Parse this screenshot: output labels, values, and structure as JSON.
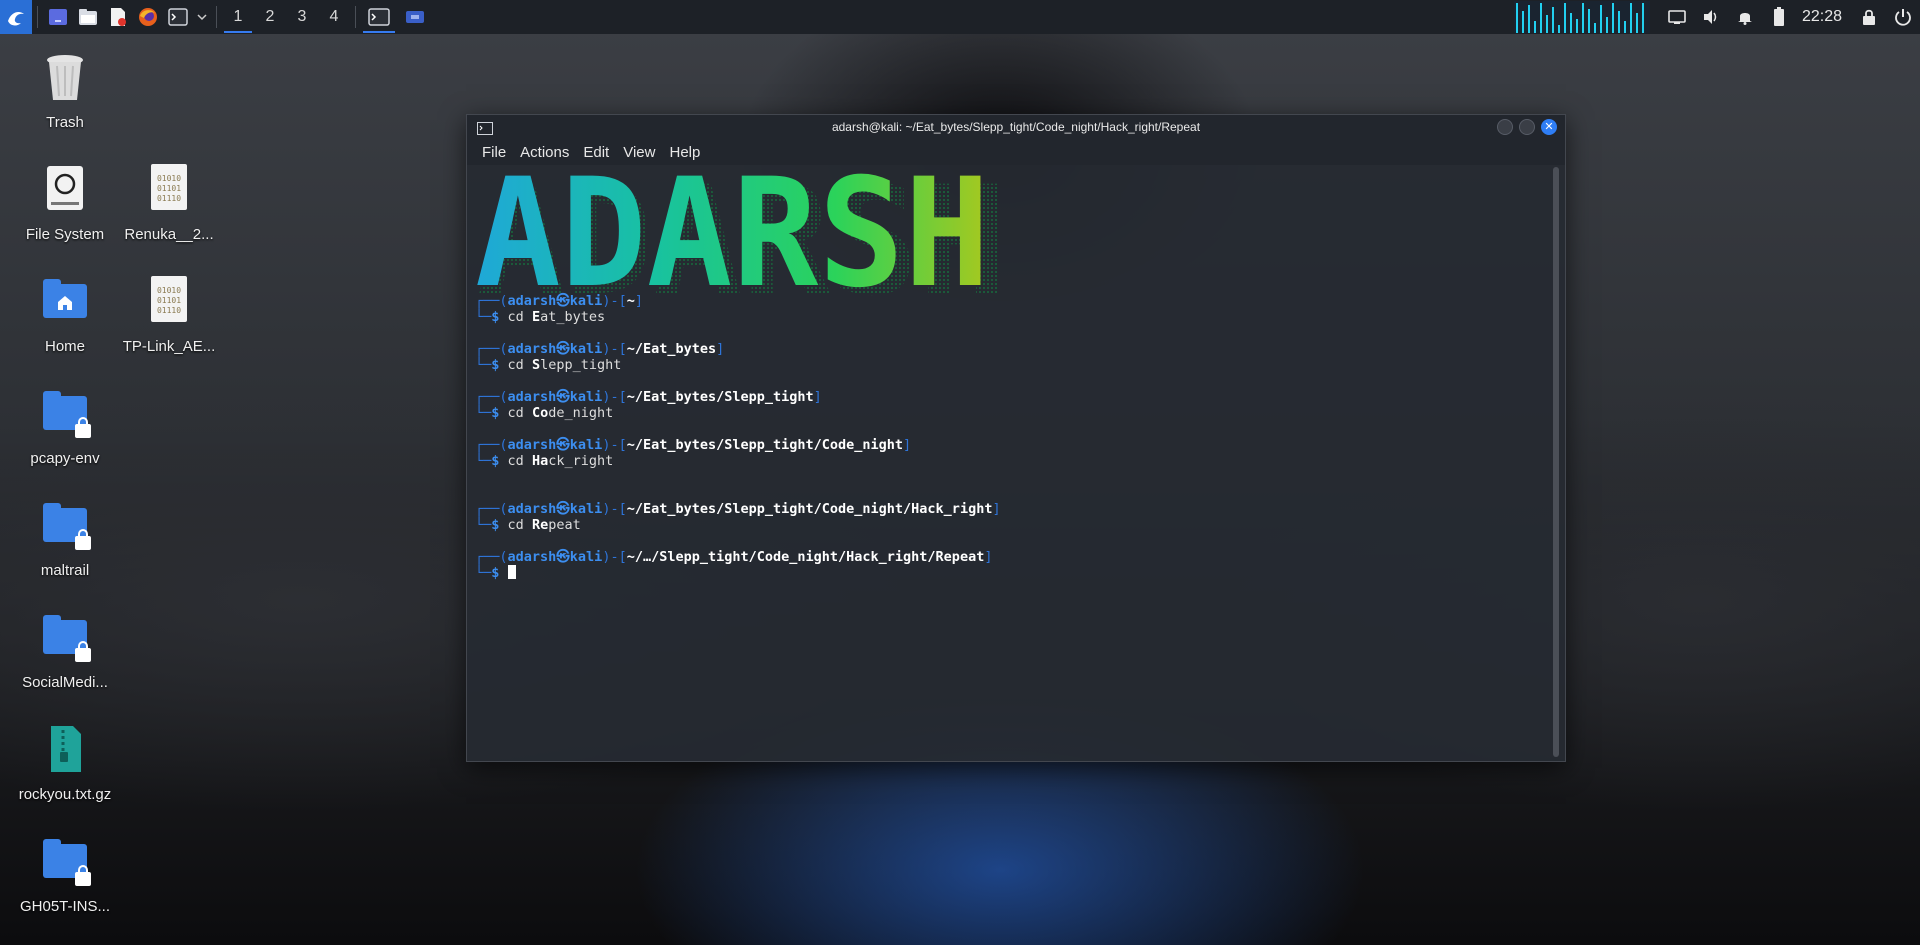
{
  "panel": {
    "workspaces": [
      "1",
      "2",
      "3",
      "4"
    ],
    "clock": "22:28",
    "icons": [
      "kali-menu-icon",
      "show-desktop-icon",
      "file-manager-icon",
      "text-editor-icon",
      "firefox-icon",
      "terminal-icon"
    ]
  },
  "desktop": {
    "icons": [
      {
        "label": "Trash",
        "icon": "trash-icon"
      },
      {
        "label": "File System",
        "icon": "drive-icon"
      },
      {
        "label": "Renuka__2...",
        "icon": "binary-file-icon"
      },
      {
        "label": "Home",
        "icon": "home-folder-icon"
      },
      {
        "label": "TP-Link_AE...",
        "icon": "binary-file-icon"
      },
      {
        "label": "pcapy-env",
        "icon": "locked-folder-icon"
      },
      {
        "label": "maltrail",
        "icon": "locked-folder-icon"
      },
      {
        "label": "SocialMedi...",
        "icon": "locked-folder-icon"
      },
      {
        "label": "rockyou.txt.gz",
        "icon": "archive-icon"
      },
      {
        "label": "GH05T-INS...",
        "icon": "locked-folder-icon"
      }
    ]
  },
  "terminal": {
    "title": "adarsh@kali: ~/Eat_bytes/Slepp_tight/Code_night/Hack_right/Repeat",
    "menu": [
      "File",
      "Actions",
      "Edit",
      "View",
      "Help"
    ],
    "banner": "ADARSH",
    "prompt_user": "adarsh",
    "prompt_host": "kali",
    "blocks": [
      {
        "path": "~",
        "cmd_first": "E",
        "cmd_rest": "at_bytes"
      },
      {
        "path": "~/Eat_bytes",
        "cmd_first": "S",
        "cmd_rest": "lepp_tight"
      },
      {
        "path": "~/Eat_bytes/Slepp_tight",
        "cmd_first": "Co",
        "cmd_rest": "de_night"
      },
      {
        "path": "~/Eat_bytes/Slepp_tight/Code_night",
        "cmd_first": "Ha",
        "cmd_rest": "ck_right"
      },
      {
        "path": "~/Eat_bytes/Slepp_tight/Code_night/Hack_right",
        "cmd_first": "Re",
        "cmd_rest": "peat"
      },
      {
        "path": "~/…/Slepp_tight/Code_night/Hack_right/Repeat"
      }
    ],
    "cmd_word": "cd",
    "prompt_symbol": "$"
  }
}
